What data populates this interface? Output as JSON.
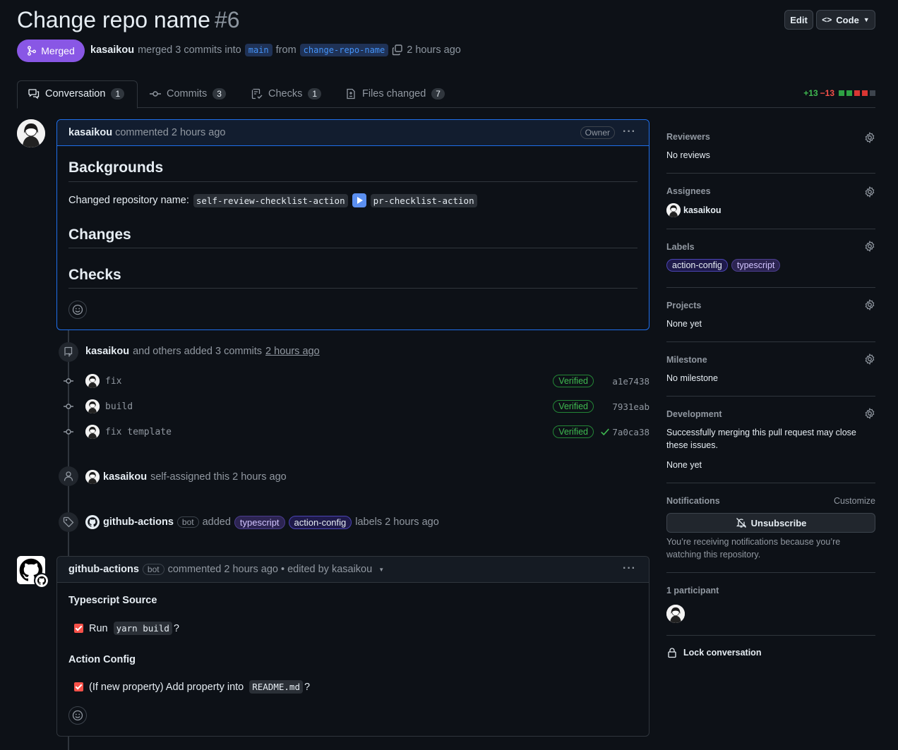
{
  "pr": {
    "title": "Change repo name",
    "number": "#6",
    "state": "Merged",
    "author": "kasaikou",
    "merge_text": "merged 3 commits into",
    "base_branch": "main",
    "from_text": "from",
    "head_branch": "change-repo-name",
    "time": "2 hours ago"
  },
  "header_buttons": {
    "edit": "Edit",
    "code": "Code"
  },
  "tabs": [
    {
      "label": "Conversation",
      "count": "1"
    },
    {
      "label": "Commits",
      "count": "3"
    },
    {
      "label": "Checks",
      "count": "1"
    },
    {
      "label": "Files changed",
      "count": "7"
    }
  ],
  "diffstat": {
    "additions": "+13",
    "deletions": "−13"
  },
  "comment1": {
    "author": "kasaikou",
    "action": "commented 2 hours ago",
    "role": "Owner",
    "menu": "···",
    "h_backgrounds": "Backgrounds",
    "changed_label": "Changed repository name:",
    "old_name": "self-review-checklist-action",
    "new_name": "pr-checklist-action",
    "h_changes": "Changes",
    "h_checks": "Checks"
  },
  "timeline": {
    "commits_author": "kasaikou",
    "commits_text": "and others added 3 commits",
    "commits_time": "2 hours ago",
    "commits": [
      {
        "message": "fix",
        "verified": "Verified",
        "sha": "a1e7438"
      },
      {
        "message": "build",
        "verified": "Verified",
        "sha": "7931eab"
      },
      {
        "message": "fix template",
        "verified": "Verified",
        "sha": "7a0ca38"
      }
    ],
    "assign_author": "kasaikou",
    "assign_text": "self-assigned this 2 hours ago",
    "label_author": "github-actions",
    "bot": "bot",
    "label_added": "added",
    "label1": "typescript",
    "label2": "action-config",
    "label_suffix": "labels 2 hours ago"
  },
  "comment2": {
    "author": "github-actions",
    "bot": "bot",
    "action": "commented 2 hours ago • edited by kasaikou",
    "menu": "···",
    "h_ts": "Typescript Source",
    "task1_pre": "Run",
    "task1_code": "yarn build",
    "task1_post": "?",
    "h_ac": "Action Config",
    "task2_pre": "(If new property) Add property into",
    "task2_code": "README.md",
    "task2_post": "?"
  },
  "sidebar": {
    "reviewers": {
      "title": "Reviewers",
      "value": "No reviews"
    },
    "assignees": {
      "title": "Assignees",
      "value": "kasaikou"
    },
    "labels": {
      "title": "Labels",
      "items": [
        "action-config",
        "typescript"
      ]
    },
    "projects": {
      "title": "Projects",
      "value": "None yet"
    },
    "milestone": {
      "title": "Milestone",
      "value": "No milestone"
    },
    "development": {
      "title": "Development",
      "line1": "Successfully merging this pull request may close",
      "line2": "these issues.",
      "value": "None yet"
    },
    "notifications": {
      "title": "Notifications",
      "customize": "Customize",
      "button": "Unsubscribe",
      "line1": "You’re receiving notifications because you’re",
      "line2": "watching this repository."
    },
    "participants": {
      "title": "1 participant"
    },
    "lock": "Lock conversation"
  },
  "colors": {
    "merged": "#8957e5",
    "accent": "#1f6feb",
    "verified": "#3fb950"
  }
}
